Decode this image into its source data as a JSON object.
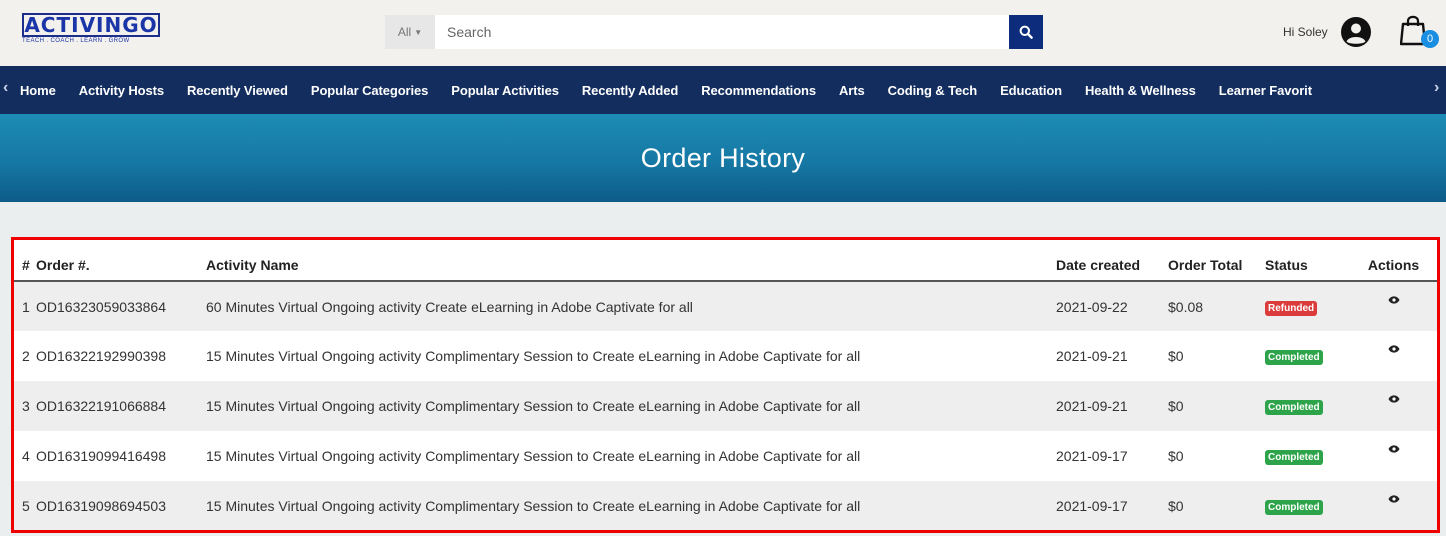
{
  "header": {
    "logo_text": "ACTIVINGO",
    "logo_tagline": "TEACH . COACH . LEARN . GROW",
    "search_scope": "All",
    "search_placeholder": "Search",
    "greeting": "Hi Soley",
    "cart_count": "0"
  },
  "nav": {
    "items": [
      "Home",
      "Activity Hosts",
      "Recently Viewed",
      "Popular Categories",
      "Popular Activities",
      "Recently Added",
      "Recommendations",
      "Arts",
      "Coding & Tech",
      "Education",
      "Health & Wellness",
      "Learner Favorit"
    ]
  },
  "banner": {
    "title": "Order History"
  },
  "table": {
    "headers": {
      "idx": "#",
      "order": "Order #.",
      "name": "Activity Name",
      "date": "Date created",
      "total": "Order Total",
      "status": "Status",
      "actions": "Actions"
    },
    "rows": [
      {
        "idx": "1",
        "order": "OD16323059033864",
        "name": "60 Minutes Virtual Ongoing activity Create eLearning in Adobe Captivate for all",
        "date": "2021-09-22",
        "total": "$0.08",
        "status": "Refunded"
      },
      {
        "idx": "2",
        "order": "OD16322192990398",
        "name": "15 Minutes Virtual Ongoing activity Complimentary Session to Create eLearning in Adobe Captivate for all",
        "date": "2021-09-21",
        "total": "$0",
        "status": "Completed"
      },
      {
        "idx": "3",
        "order": "OD16322191066884",
        "name": "15 Minutes Virtual Ongoing activity Complimentary Session to Create eLearning in Adobe Captivate for all",
        "date": "2021-09-21",
        "total": "$0",
        "status": "Completed"
      },
      {
        "idx": "4",
        "order": "OD16319099416498",
        "name": "15 Minutes Virtual Ongoing activity Complimentary Session to Create eLearning in Adobe Captivate for all",
        "date": "2021-09-17",
        "total": "$0",
        "status": "Completed"
      },
      {
        "idx": "5",
        "order": "OD16319098694503",
        "name": "15 Minutes Virtual Ongoing activity Complimentary Session to Create eLearning in Adobe Captivate for all",
        "date": "2021-09-17",
        "total": "$0",
        "status": "Completed"
      }
    ]
  },
  "colors": {
    "nav_bg": "#122d5e",
    "search_button": "#0d2d7c",
    "badge_refunded": "#db3b3b",
    "badge_completed": "#2da44a",
    "highlight_border": "#ee0000"
  },
  "icons": {
    "search": "search-icon",
    "user": "user-circle-icon",
    "cart": "shopping-bag-icon",
    "view": "eye-icon"
  }
}
